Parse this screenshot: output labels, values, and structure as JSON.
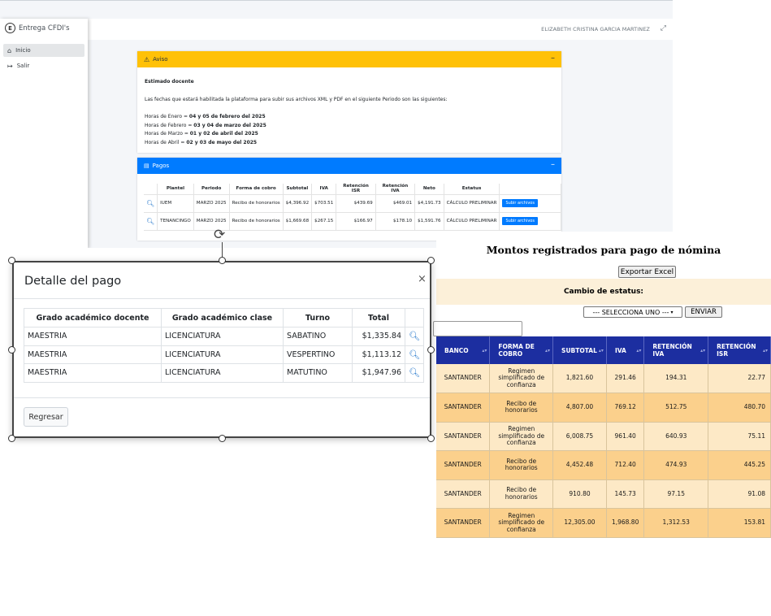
{
  "app": {
    "brand": "Entrega CFDI's",
    "brand_logo": "E",
    "user_name": "ELIZABETH CRISTINA GARCIA MARTINEZ",
    "nav": [
      {
        "label": "Inicio",
        "icon": "home-icon"
      },
      {
        "label": "Salir",
        "icon": "sign-out-icon"
      }
    ],
    "aviso": {
      "title": "Aviso",
      "greeting": "Estimado docente",
      "intro": "Las fechas que estará habilitada la plataforma para subir sus archivos XML y PDF en el siguiente Periodo son las siguientes:",
      "dates": [
        {
          "label": "Horas de Enero = ",
          "value": "04 y 05 de febrero del 2025"
        },
        {
          "label": "Horas de Febrero = ",
          "value": "03 y 04 de marzo del 2025"
        },
        {
          "label": "Horas de Marzo = ",
          "value": "01 y 02 de abril del 2025"
        },
        {
          "label": "Horas de Abril = ",
          "value": "02 y 03 de mayo del 2025"
        }
      ]
    },
    "pagos": {
      "title": "Pagos",
      "headers": [
        "",
        "Plantel",
        "Periodo",
        "Forma de cobro",
        "Subtotal",
        "IVA",
        "Retención ISR",
        "Retención IVA",
        "Neto",
        "Estatus",
        ""
      ],
      "rows": [
        {
          "plantel": "IUEM",
          "periodo": "MARZO 2025",
          "forma": "Recibo de honorarios",
          "subtotal": "$4,396.92",
          "iva": "$703.51",
          "ret_isr": "$439.69",
          "ret_iva": "$469.01",
          "neto": "$4,191.73",
          "estatus": "CÁLCULO PRELIMINAR",
          "action": "Subir archivos"
        },
        {
          "plantel": "TENANCINGO",
          "periodo": "MARZO 2025",
          "forma": "Recibo de honorarios",
          "subtotal": "$1,669.68",
          "iva": "$267.15",
          "ret_isr": "$166.97",
          "ret_iva": "$178.10",
          "neto": "$1,591.76",
          "estatus": "CÁLCULO PRELIMINAR",
          "action": "Subir archivos"
        }
      ]
    }
  },
  "dialog": {
    "title": "Detalle del pago",
    "headers": [
      "Grado académico docente",
      "Grado académico clase",
      "Turno",
      "Total"
    ],
    "rows": [
      {
        "docente": "MAESTRIA",
        "clase": "LICENCIATURA",
        "turno": "SABATINO",
        "total": "$1,335.84"
      },
      {
        "docente": "MAESTRIA",
        "clase": "LICENCIATURA",
        "turno": "VESPERTINO",
        "total": "$1,113.12"
      },
      {
        "docente": "MAESTRIA",
        "clase": "LICENCIATURA",
        "turno": "MATUTINO",
        "total": "$1,947.96"
      }
    ],
    "back_label": "Regresar"
  },
  "montos": {
    "title": "Montos registrados para pago de nómina",
    "export_label": "Exportar Excel",
    "estatus_label": "Cambio de estatus:",
    "select_value": "--- SELECCIONA UNO ---",
    "send_label": "ENVIAR",
    "headers": [
      "BANCO",
      "FORMA DE COBRO",
      "SUBTOTAL",
      "IVA",
      "RETENCIÓN IVA",
      "RETENCIÓN ISR"
    ],
    "rows": [
      {
        "banco": "SANTANDER",
        "forma": "Regimen simplificado de confianza",
        "subtotal": "1,821.60",
        "iva": "291.46",
        "ret_iva": "194.31",
        "ret_isr": "22.77"
      },
      {
        "banco": "SANTANDER",
        "forma": "Recibo de honorarios",
        "subtotal": "4,807.00",
        "iva": "769.12",
        "ret_iva": "512.75",
        "ret_isr": "480.70"
      },
      {
        "banco": "SANTANDER",
        "forma": "Regimen simplificado de confianza",
        "subtotal": "6,008.75",
        "iva": "961.40",
        "ret_iva": "640.93",
        "ret_isr": "75.11"
      },
      {
        "banco": "SANTANDER",
        "forma": "Recibo de honorarios",
        "subtotal": "4,452.48",
        "iva": "712.40",
        "ret_iva": "474.93",
        "ret_isr": "445.25"
      },
      {
        "banco": "SANTANDER",
        "forma": "Recibo de honorarios",
        "subtotal": "910.80",
        "iva": "145.73",
        "ret_iva": "97.15",
        "ret_isr": "91.08"
      },
      {
        "banco": "SANTANDER",
        "forma": "Regimen simplificado de confianza",
        "subtotal": "12,305.00",
        "iva": "1,968.80",
        "ret_iva": "1,312.53",
        "ret_isr": "153.81"
      }
    ]
  }
}
